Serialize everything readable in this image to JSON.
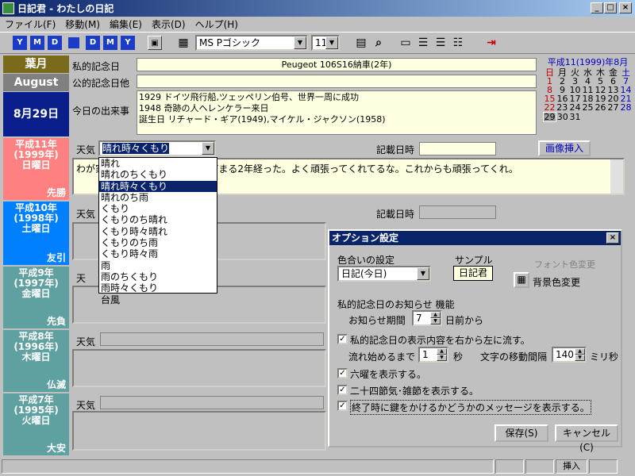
{
  "window": {
    "title": "日記君 - わたしの日記"
  },
  "menu": [
    "ファイル(F)",
    "移動(M)",
    "編集(E)",
    "表示(D)",
    "ヘルプ(H)"
  ],
  "toolbar": {
    "nav": [
      "Y",
      "M",
      "D",
      "",
      "D",
      "M",
      "Y"
    ],
    "font": "MS Pゴシック",
    "size": "11"
  },
  "header": {
    "month_jp": "葉月",
    "month_en": "August",
    "date": "8月29日"
  },
  "fields": {
    "private_label": "私的記念日",
    "private_value": "Peugeot 106S16納車(2年)",
    "public_label": "公的記念日他",
    "events_label": "今日の出来事",
    "events": [
      "1929 ドイツ飛行船,ツェッペリン伯号、世界一周に成功",
      "1948 奇跡の人ヘレンケラー来日",
      "誕生日 リチャード・ギア(1949),マイケル・ジャクソン(1958)"
    ]
  },
  "calendar": {
    "title": "平成11(1999)年8月",
    "weekdays": [
      "日",
      "月",
      "火",
      "水",
      "木",
      "金",
      "土"
    ],
    "rows": [
      [
        "1",
        "2",
        "3",
        "4",
        "5",
        "6",
        "7"
      ],
      [
        "8",
        "9",
        "10",
        "11",
        "12",
        "13",
        "14"
      ],
      [
        "15",
        "16",
        "17",
        "18",
        "19",
        "20",
        "21"
      ],
      [
        "22",
        "23",
        "24",
        "25",
        "26",
        "27",
        "28"
      ],
      [
        "29",
        "30",
        "31",
        "",
        "",
        "",
        ""
      ]
    ]
  },
  "entries": [
    {
      "era": "平成11年",
      "year": "(1999年)",
      "weekday": "日曜日",
      "rokuyo": "先勝",
      "color": "#ff8080",
      "weather_label": "天気",
      "weather": "晴れ時々くもり",
      "time_label": "記載日時",
      "text": "わが家に初めてのマイカーが来てまる2年経った。よく頑張ってくれてるな。これからも頑張ってくれ。"
    },
    {
      "era": "平成10年",
      "year": "(1998年)",
      "weekday": "土曜日",
      "rokuyo": "友引",
      "color": "#0080ff",
      "weather_label": "天気",
      "time_label": "記載日時"
    },
    {
      "era": "平成9年",
      "year": "(1997年)",
      "weekday": "金曜日",
      "rokuyo": "先負",
      "color": "#5fa0a0"
    },
    {
      "era": "平成8年",
      "year": "(1996年)",
      "weekday": "木曜日",
      "rokuyo": "仏滅",
      "color": "#5fa0a0",
      "weather_label": "天気"
    },
    {
      "era": "平成7年",
      "year": "(1995年)",
      "weekday": "火曜日",
      "rokuyo": "大安",
      "color": "#5fa0a0",
      "weather_label": "天気"
    }
  ],
  "image_button": "画像挿入",
  "weather_options": [
    "晴れ",
    "晴れのちくもり",
    "晴れ時々くもり",
    "晴れのち雨",
    "くもり",
    "くもりのち晴れ",
    "くもり時々晴れ",
    "くもりのち雨",
    "くもり時々雨",
    "雨",
    "雨のちくもり",
    "雨時々くもり",
    "台風"
  ],
  "dialog": {
    "title": "オプション設定",
    "color_label": "色合いの設定",
    "sample_label": "サンプル",
    "color_value": "日記(今日)",
    "sample_value": "日記君",
    "font_color": "フォント色変更",
    "bg_color": "背景色変更",
    "notify_label": "私的記念日のお知らせ 機能",
    "period_label": "お知らせ期間",
    "period_value": "7",
    "period_unit": "日前から",
    "scroll_check": "私的記念日の表示内容を右から左に流す。",
    "start_label": "流れ始めるまで",
    "start_value": "1",
    "start_unit": "秒",
    "interval_label": "文字の移動間隔",
    "interval_value": "140",
    "interval_unit": "ミリ秒",
    "rokuyo_check": "六曜を表示する。",
    "sekki_check": "二十四節気･雑節を表示する。",
    "key_check": "終了時に鍵をかけるかどうかのメッセージを表示する。",
    "save": "保存(S)",
    "cancel": "キャンセル(C)"
  },
  "status": {
    "insert": "挿入"
  }
}
